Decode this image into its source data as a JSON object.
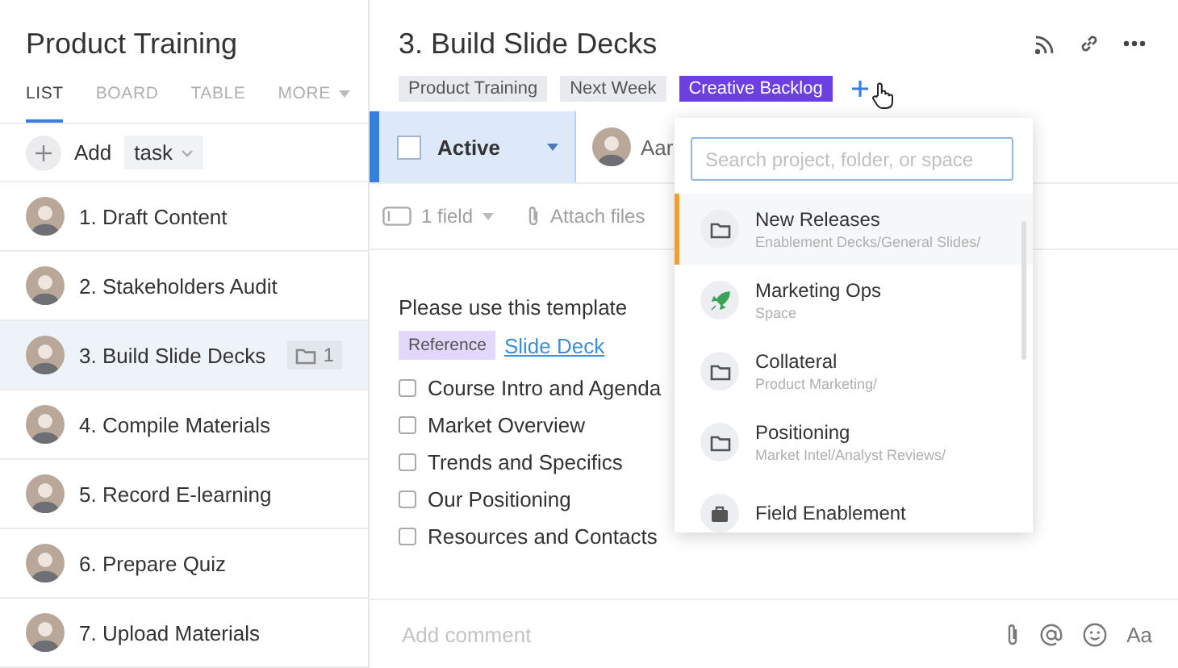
{
  "sidebar": {
    "title": "Product Training",
    "tabs": [
      {
        "label": "LIST",
        "selected": true
      },
      {
        "label": "BOARD",
        "selected": false
      },
      {
        "label": "TABLE",
        "selected": false
      },
      {
        "label": "MORE",
        "selected": false,
        "kind": "menu"
      }
    ],
    "add": {
      "label": "Add",
      "type": "task"
    },
    "tasks": [
      {
        "title": "1. Draft Content",
        "selected": false
      },
      {
        "title": "2. Stakeholders Audit",
        "selected": false
      },
      {
        "title": "3. Build Slide Decks",
        "selected": true,
        "attachments": "1"
      },
      {
        "title": "4. Compile Materials",
        "selected": false
      },
      {
        "title": "5. Record E-learning",
        "selected": false
      },
      {
        "title": "6. Prepare Quiz",
        "selected": false
      },
      {
        "title": "7. Upload Materials",
        "selected": false
      }
    ]
  },
  "task": {
    "title": "3. Build Slide Decks",
    "tags": [
      {
        "label": "Product Training",
        "color": "#e9eaee"
      },
      {
        "label": "Next Week",
        "color": "#e9eaee"
      },
      {
        "label": "Creative Backlog",
        "color": "#6b3fe0"
      }
    ],
    "status": {
      "label": "Active",
      "checked": false
    },
    "assignee": {
      "name": "Aar"
    },
    "fields": {
      "count": "1 field",
      "attach": "Attach files"
    },
    "description": {
      "intro": "Please use this template",
      "reference_tag": "Reference",
      "link": "Slide Deck",
      "checklist": [
        {
          "label": "Course Intro and Agenda",
          "checked": false
        },
        {
          "label": "Market Overview",
          "checked": false
        },
        {
          "label": "Trends and Specifics",
          "checked": false
        },
        {
          "label": "Our Positioning",
          "checked": false
        },
        {
          "label": "Resources and Contacts",
          "checked": false
        }
      ]
    },
    "comment": {
      "placeholder": "Add comment",
      "format": "Aa"
    }
  },
  "location_picker": {
    "placeholder": "Search project, folder, or space",
    "items": [
      {
        "name": "New Releases",
        "path": "Enablement Decks/General Slides/",
        "kind": "folder",
        "selected": true
      },
      {
        "name": "Marketing Ops",
        "path": "Space",
        "kind": "space",
        "selected": false
      },
      {
        "name": "Collateral",
        "path": "Product Marketing/",
        "kind": "folder",
        "selected": false
      },
      {
        "name": "Positioning",
        "path": "Market Intel/Analyst Reviews/",
        "kind": "folder",
        "selected": false
      },
      {
        "name": "Field Enablement",
        "kind": "project",
        "selected": false
      }
    ]
  }
}
